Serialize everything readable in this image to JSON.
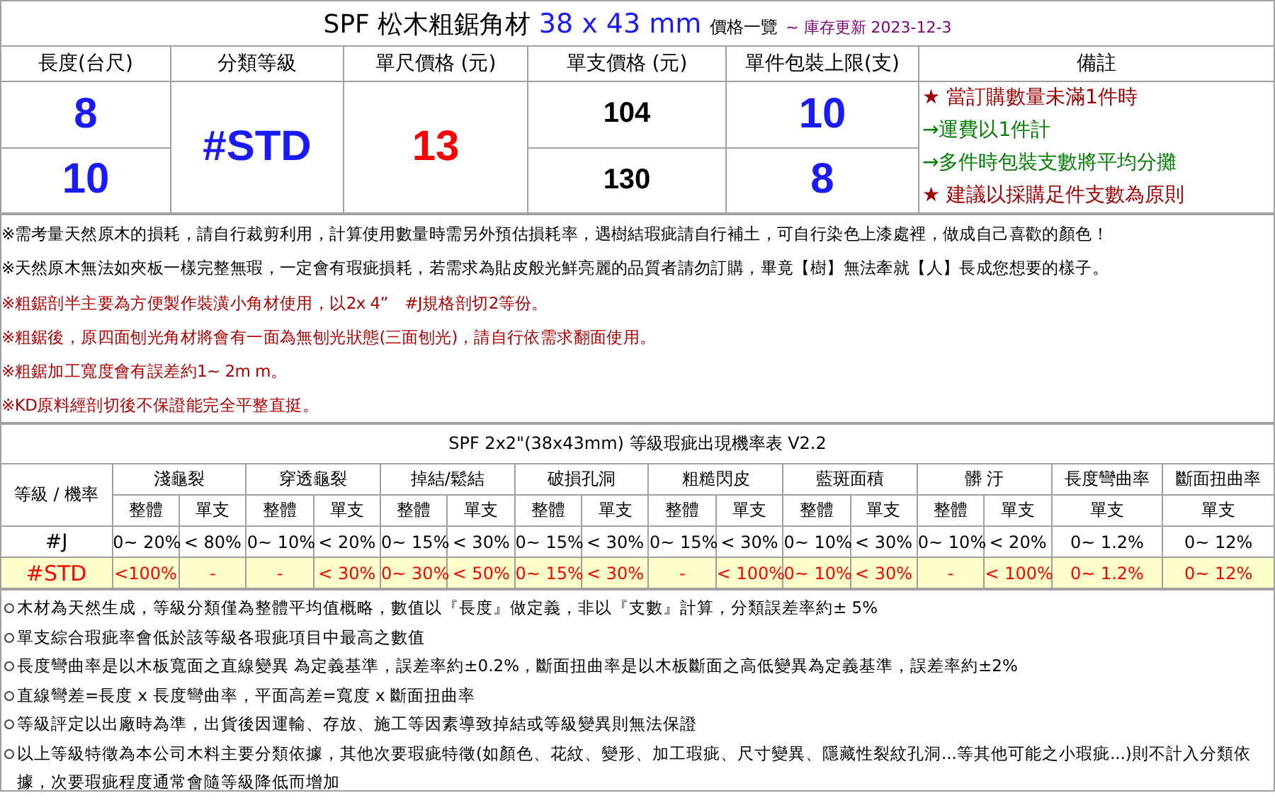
{
  "price_table": {
    "title": {
      "product": "SPF 松木粗鋸角材",
      "size": "38 x 43 mm",
      "suffix": "價格一覽",
      "updated": "~ 庫存更新 2023-12-3"
    },
    "columns": [
      "長度(台尺)",
      "分類等級",
      "單尺價格 (元)",
      "單支價格 (元)",
      "單件包裝上限(支)",
      "備註"
    ],
    "grade": "#STD",
    "unit_price": "13",
    "rows": [
      {
        "length": "8",
        "piece_price": "104",
        "pack_limit": "10"
      },
      {
        "length": "10",
        "piece_price": "130",
        "pack_limit": "8"
      }
    ],
    "remarks": [
      {
        "kind": "star",
        "text": "★ 當訂購數量未滿1件時"
      },
      {
        "kind": "arrow",
        "text": "→運費以1件計"
      },
      {
        "kind": "arrow",
        "text": "→多件時包裝支數將平均分攤"
      },
      {
        "kind": "star",
        "text": "★ 建議以採購足件支數為原則"
      }
    ]
  },
  "notes": [
    {
      "kind": "plain",
      "text": "※需考量天然原木的損耗，請自行裁剪利用，計算使用數量時需另外預估損耗率，遇樹結瑕疵請自行補土，可自行染色上漆處裡，做成自己喜歡的顏色！"
    },
    {
      "kind": "plain",
      "text": "※天然原木無法如夾板一樣完整無瑕，一定會有瑕疵損耗，若需求為貼皮般光鮮亮麗的品質者請勿訂購，畢竟【樹】無法牽就【人】長成您想要的樣子。"
    },
    {
      "kind": "warning",
      "text": "※粗鋸剖半主要為方便製作裝潢小角材使用，以2x 4”　#J規格剖切2等份。"
    },
    {
      "kind": "warning",
      "text": "※粗鋸後，原四面刨光角材將會有一面為無刨光狀態(三面刨光)，請自行依需求翻面使用。"
    },
    {
      "kind": "warning",
      "text": "※粗鋸加工寬度會有誤差約1~ 2m m。"
    },
    {
      "kind": "warning",
      "text": "※KD原料經剖切後不保證能完全平整直挺。"
    }
  ],
  "defect_table": {
    "title": "SPF 2x2\"(38x43mm) 等級瑕疵出現機率表 V2.2",
    "corner": "等級 / 機率",
    "groups": [
      {
        "label": "淺龜裂",
        "subs": [
          "整體",
          "單支"
        ]
      },
      {
        "label": "穿透龜裂",
        "subs": [
          "整體",
          "單支"
        ]
      },
      {
        "label": "掉結/鬆結",
        "subs": [
          "整體",
          "單支"
        ]
      },
      {
        "label": "破損孔洞",
        "subs": [
          "整體",
          "單支"
        ]
      },
      {
        "label": "粗糙閃皮",
        "subs": [
          "整體",
          "單支"
        ]
      },
      {
        "label": "藍斑面積",
        "subs": [
          "整體",
          "單支"
        ]
      },
      {
        "label": "髒 汙",
        "subs": [
          "整體",
          "單支"
        ]
      },
      {
        "label": "長度彎曲率",
        "subs": [
          "單支"
        ]
      },
      {
        "label": "斷面扭曲率",
        "subs": [
          "單支"
        ]
      }
    ],
    "rows": [
      {
        "grade": "#J",
        "highlighted": false,
        "cells": [
          "0~ 20%",
          "< 80%",
          "0~ 10%",
          "< 20%",
          "0~ 15%",
          "< 30%",
          "0~ 15%",
          "< 30%",
          "0~ 15%",
          "< 30%",
          "0~ 10%",
          "< 30%",
          "0~ 10%",
          "< 20%",
          "0~ 1.2%",
          "0~ 12%"
        ]
      },
      {
        "grade": "#STD",
        "highlighted": true,
        "cells": [
          "<100%",
          "-",
          "-",
          "< 30%",
          "0~ 30%",
          "< 50%",
          "0~ 15%",
          "< 30%",
          "-",
          "< 100%",
          "0~ 10%",
          "< 30%",
          "-",
          "< 100%",
          "0~ 1.2%",
          "0~ 12%"
        ]
      }
    ]
  },
  "footnotes": [
    "木材為天然生成，等級分類僅為整體平均值概略，數值以『長度』做定義，非以『支數』計算，分類誤差率約± 5%",
    "單支綜合瑕疵率會低於該等級各瑕疵項目中最高之數值",
    "長度彎曲率是以木板寬面之直線變異 為定義基準，誤差率約±0.2%，斷面扭曲率是以木板斷面之高低變異為定義基準，誤差率約±2%",
    "直線彎差=長度 x 長度彎曲率，平面高差=寬度 x 斷面扭曲率",
    "等級評定以出廠時為準，出貨後因運輸、存放、施工等因素導致掉結或等級變異則無法保證",
    "以上等級特徵為本公司木料主要分類依據，其他次要瑕疵特徵(如顏色、花紋、變形、加工瑕疵、尺寸變異、隱藏性裂紋孔洞...等其他可能之小瑕疵...)則不計入分類依據，次要瑕疵程度通常會隨等級降低而增加"
  ]
}
